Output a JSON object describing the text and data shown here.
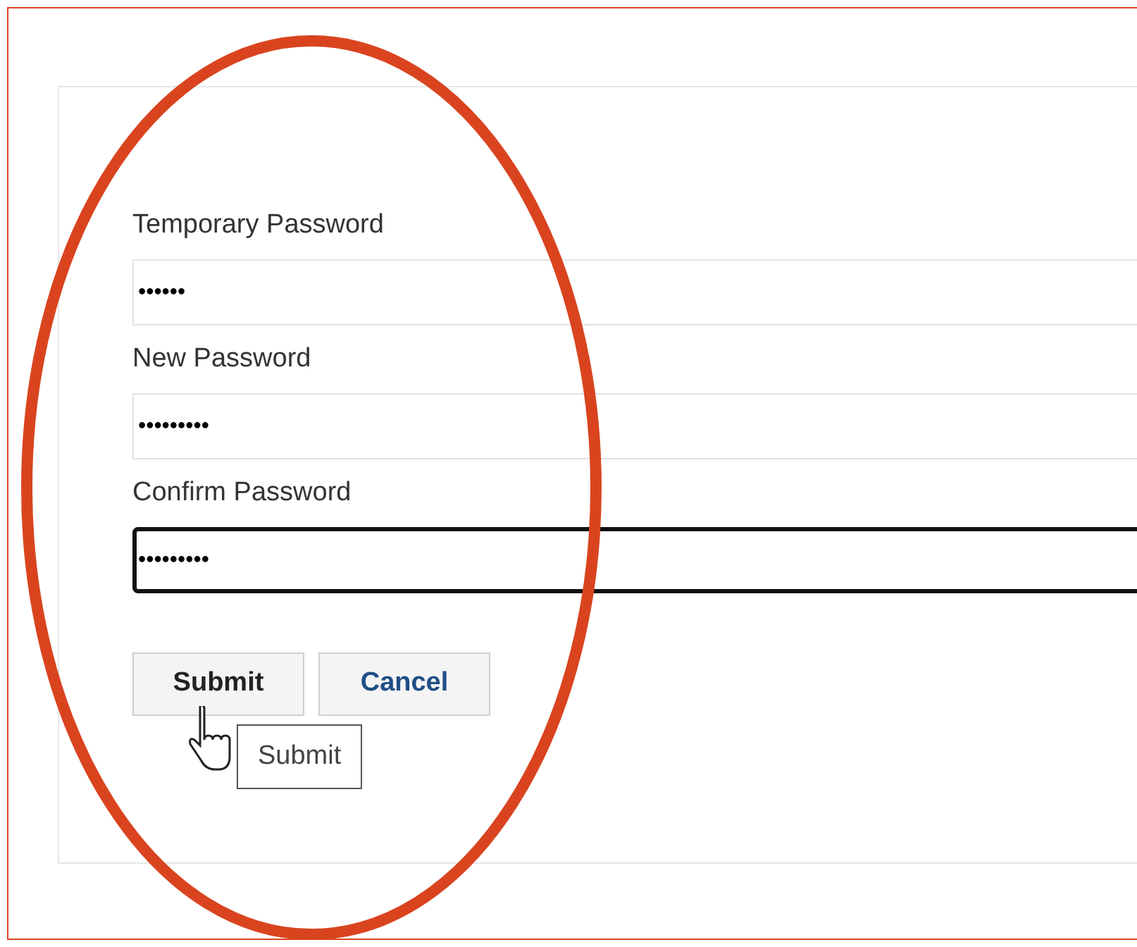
{
  "fields": [
    {
      "label": "Temporary Password",
      "value": "••••••",
      "focused": false
    },
    {
      "label": "New Password",
      "value": "•••••••••",
      "focused": false
    },
    {
      "label": "Confirm Password",
      "value": "•••••••••",
      "focused": true
    }
  ],
  "buttons": [
    {
      "label": "Submit",
      "kind": "primary"
    },
    {
      "label": "Cancel",
      "kind": "secondary"
    }
  ],
  "tooltip": "Submit"
}
